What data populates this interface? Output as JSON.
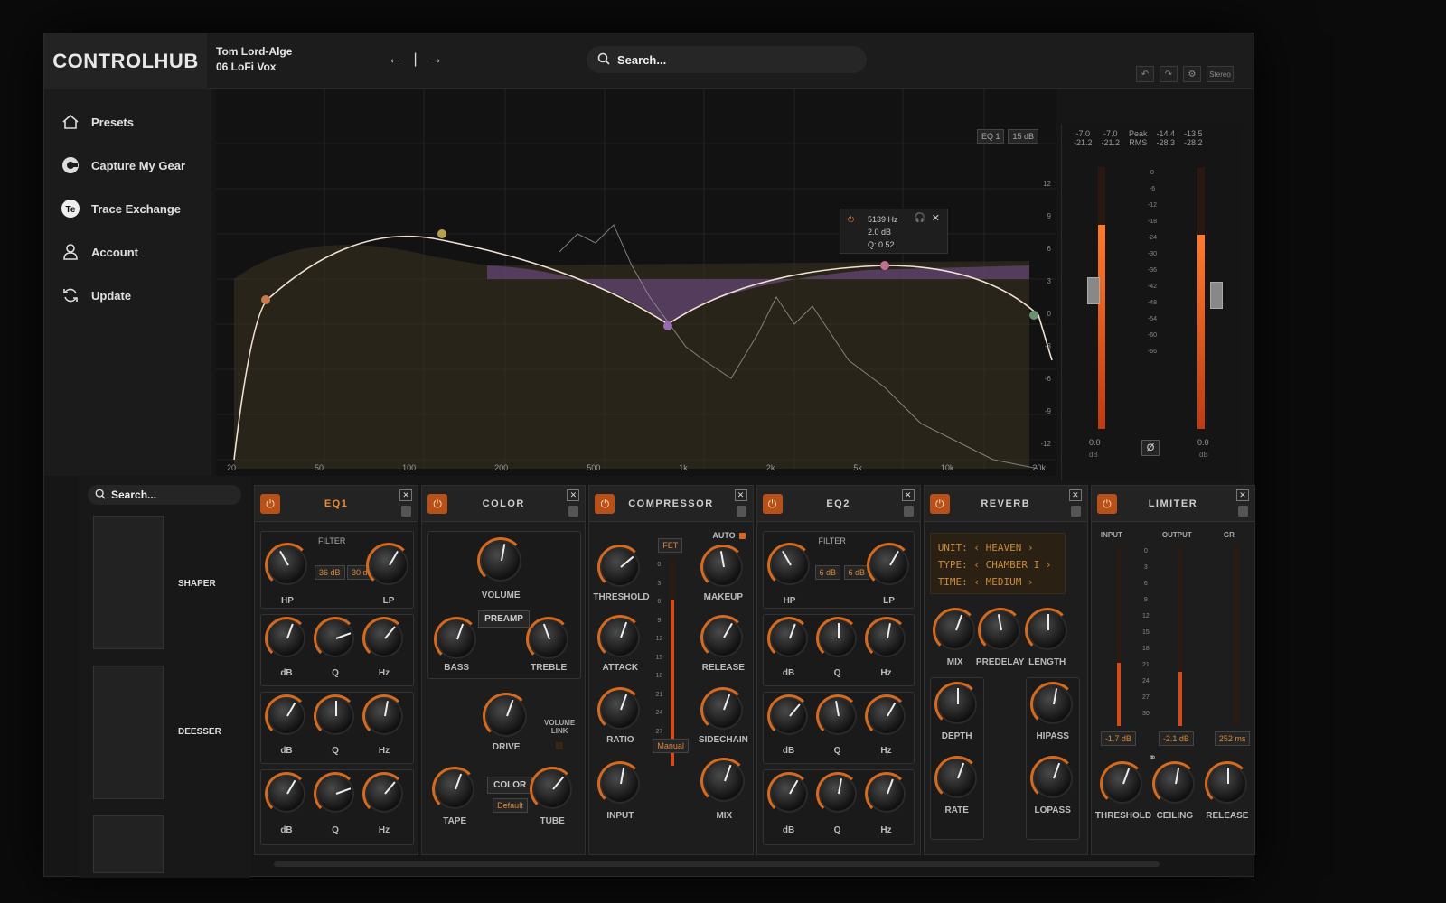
{
  "app": {
    "logo": "CONTROLHUB"
  },
  "track": {
    "artist": "Tom Lord-Alge",
    "preset": "06 LoFi Vox",
    "nav": "← | →"
  },
  "search": {
    "placeholder": "Search..."
  },
  "toolbar": {
    "undo": "↶",
    "redo": "↷",
    "settings": "⚙",
    "mode": "Stereo"
  },
  "sidebar": {
    "items": [
      {
        "label": "Presets",
        "icon": "home-icon"
      },
      {
        "label": "Capture My Gear",
        "icon": "capture-icon"
      },
      {
        "label": "Trace Exchange",
        "icon": "trace-exchange-icon"
      },
      {
        "label": "Account",
        "icon": "account-icon"
      },
      {
        "label": "Update",
        "icon": "update-icon"
      }
    ]
  },
  "eq_display": {
    "badges": [
      "EQ 1",
      "15 dB"
    ],
    "freq_labels": [
      "20",
      "50",
      "100",
      "200",
      "500",
      "1k",
      "2k",
      "5k",
      "10k",
      "20k"
    ],
    "db_labels": [
      "12",
      "9",
      "6",
      "3",
      "0",
      "-3",
      "-6",
      "-9",
      "-12"
    ],
    "tooltip": {
      "freq": "5139 Hz",
      "gain": "2.0 dB",
      "q": "Q: 0.52"
    }
  },
  "meters": {
    "header": [
      "-7.0",
      "-7.0",
      "Peak",
      "-14.4",
      "-13.5",
      "",
      "-21.2",
      "-21.2",
      "RMS",
      "-28.3",
      "-28.2",
      ""
    ],
    "scale": [
      "0",
      "-6",
      "-12",
      "-18",
      "-24",
      "-30",
      "-36",
      "-42",
      "-48",
      "-54",
      "-60",
      "-66"
    ],
    "left_value": "0.0",
    "right_value": "0.0",
    "unit": "dB",
    "phase": "Ø",
    "left_level": 0.78,
    "right_level": 0.74
  },
  "browser": {
    "search_placeholder": "Search...",
    "items": [
      {
        "label": "SHAPER"
      },
      {
        "label": "DEESSER"
      }
    ]
  },
  "rack": {
    "eq1": {
      "title": "EQ1",
      "filter": "FILTER",
      "hp": "HP",
      "lp": "LP",
      "slope1": "36 dB",
      "slope2": "30 dB",
      "bands": [
        [
          "dB",
          "Q",
          "Hz"
        ],
        [
          "dB",
          "Q",
          "Hz"
        ],
        [
          "dB",
          "Q",
          "Hz"
        ]
      ]
    },
    "color": {
      "title": "COLOR",
      "volume": "VOLUME",
      "preamp": "PREAMP",
      "bass": "BASS",
      "treble": "TREBLE",
      "drive": "DRIVE",
      "volume_link": "VOLUME LINK",
      "color_btn": "COLOR",
      "default": "Default",
      "tape": "TAPE",
      "tube": "TUBE"
    },
    "compressor": {
      "title": "COMPRESSOR",
      "fet": "FET",
      "auto": "AUTO",
      "threshold": "THRESHOLD",
      "makeup": "MAKEUP",
      "attack": "ATTACK",
      "release": "RELEASE",
      "ratio": "RATIO",
      "sidechain": "SIDECHAIN",
      "manual": "Manual",
      "input": "INPUT",
      "mix": "MIX",
      "scale": [
        "0",
        "3",
        "6",
        "9",
        "12",
        "15",
        "18",
        "21",
        "24",
        "27",
        "30"
      ]
    },
    "eq2": {
      "title": "EQ2",
      "filter": "FILTER",
      "hp": "HP",
      "lp": "LP",
      "slope1": "6 dB",
      "slope2": "6 dB",
      "bands": [
        [
          "dB",
          "Q",
          "Hz"
        ],
        [
          "dB",
          "Q",
          "Hz"
        ],
        [
          "dB",
          "Q",
          "Hz"
        ]
      ]
    },
    "reverb": {
      "title": "REVERB",
      "lcd": [
        "UNIT: ‹ HEAVEN ›",
        "TYPE: ‹ CHAMBER I ›",
        "TIME: ‹ MEDIUM ›"
      ],
      "mix": "MIX",
      "predelay": "PREDELAY",
      "length": "LENGTH",
      "depth": "DEPTH",
      "hipass": "HIPASS",
      "rate": "RATE",
      "lopass": "LOPASS"
    },
    "limiter": {
      "title": "LIMITER",
      "input": "INPUT",
      "output": "OUTPUT",
      "gr": "GR",
      "in_val": "-1.7 dB",
      "out_val": "-2.1 dB",
      "gr_val": "252 ms",
      "threshold": "THRESHOLD",
      "ceiling": "CEILING",
      "release": "RELEASE",
      "scale": [
        "0",
        "3",
        "6",
        "9",
        "12",
        "15",
        "18",
        "21",
        "24",
        "27",
        "30"
      ]
    }
  }
}
